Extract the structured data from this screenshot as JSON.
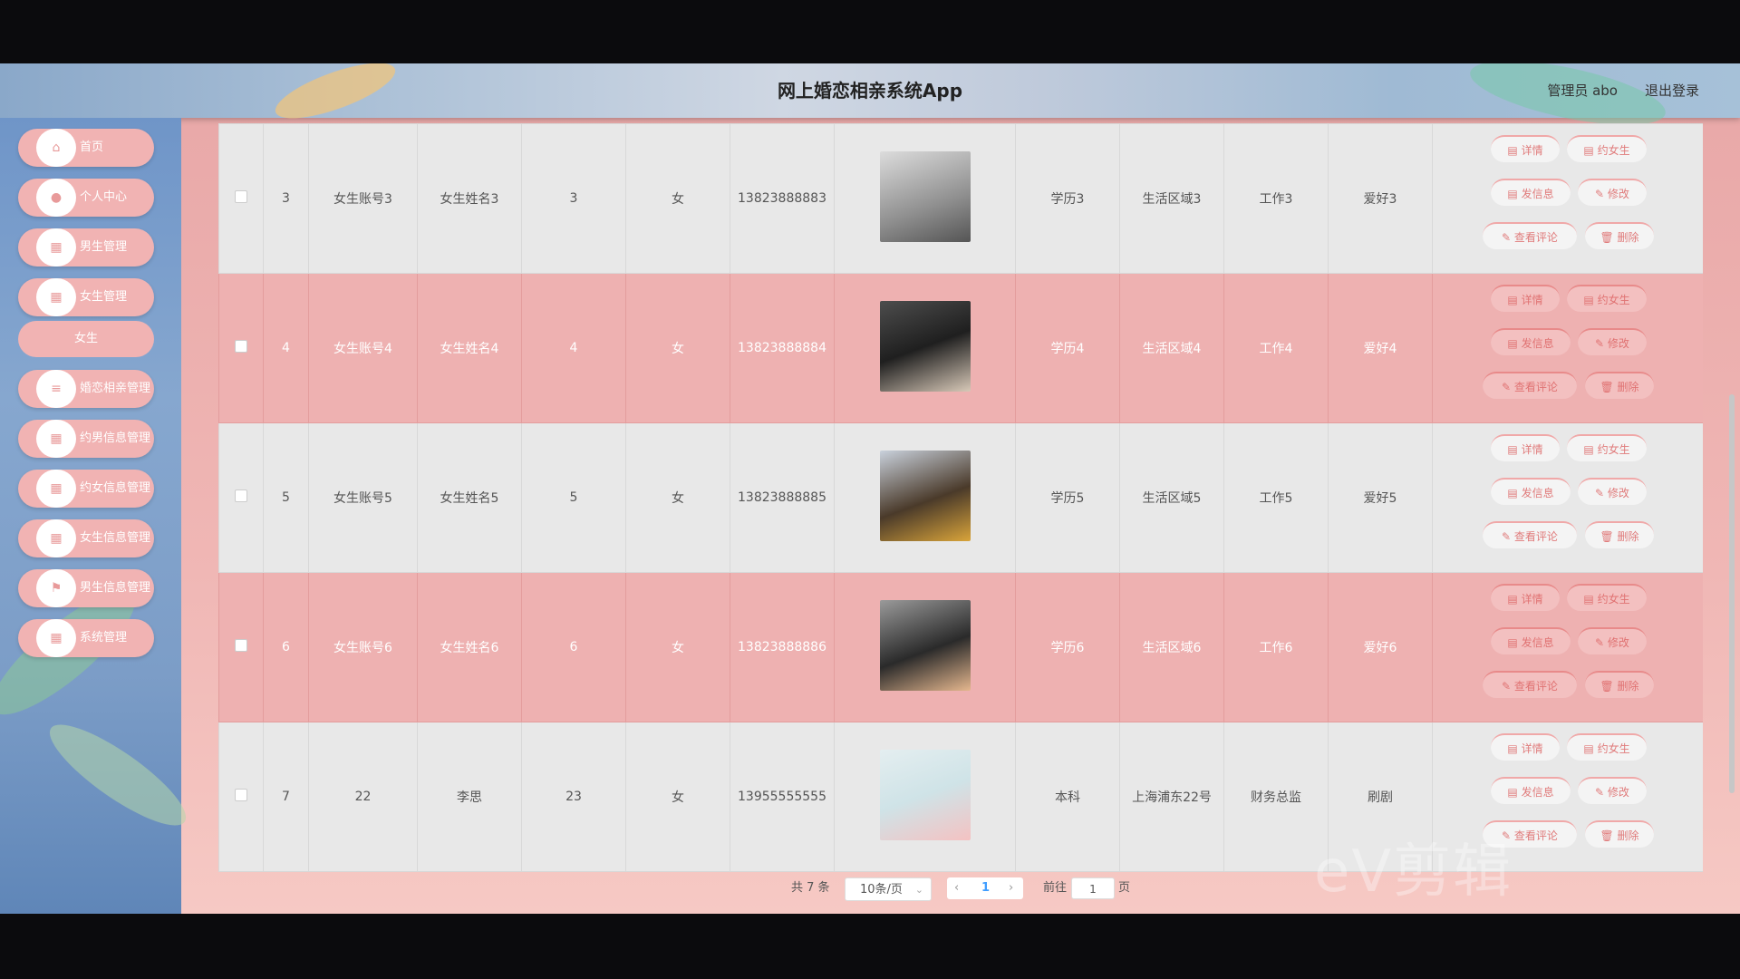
{
  "header": {
    "title": "网上婚恋相亲系统App",
    "admin": "管理员 abo",
    "logout": "退出登录"
  },
  "sidebar": {
    "items": [
      {
        "label": "首页",
        "icon": "home-icon"
      },
      {
        "label": "个人中心",
        "icon": "user-icon"
      },
      {
        "label": "男生管理",
        "icon": "grid-icon"
      },
      {
        "label": "女生管理",
        "icon": "grid-icon"
      },
      {
        "label": "婚恋相亲管理",
        "icon": "sliders-icon"
      },
      {
        "label": "约男信息管理",
        "icon": "grid-icon"
      },
      {
        "label": "约女信息管理",
        "icon": "grid-icon"
      },
      {
        "label": "女生信息管理",
        "icon": "grid-icon"
      },
      {
        "label": "男生信息管理",
        "icon": "flag-icon"
      },
      {
        "label": "系统管理",
        "icon": "grid-icon"
      }
    ],
    "submenu_item": "女生"
  },
  "table": {
    "rows": [
      {
        "idx": "3",
        "account": "女生账号3",
        "name": "女生姓名3",
        "age": "3",
        "gender": "女",
        "phone": "13823888883",
        "edu": "学历3",
        "area": "生活区域3",
        "job": "工作3",
        "hobby": "爱好3"
      },
      {
        "idx": "4",
        "account": "女生账号4",
        "name": "女生姓名4",
        "age": "4",
        "gender": "女",
        "phone": "13823888884",
        "edu": "学历4",
        "area": "生活区域4",
        "job": "工作4",
        "hobby": "爱好4"
      },
      {
        "idx": "5",
        "account": "女生账号5",
        "name": "女生姓名5",
        "age": "5",
        "gender": "女",
        "phone": "13823888885",
        "edu": "学历5",
        "area": "生活区域5",
        "job": "工作5",
        "hobby": "爱好5"
      },
      {
        "idx": "6",
        "account": "女生账号6",
        "name": "女生姓名6",
        "age": "6",
        "gender": "女",
        "phone": "13823888886",
        "edu": "学历6",
        "area": "生活区域6",
        "job": "工作6",
        "hobby": "爱好6"
      },
      {
        "idx": "7",
        "account": "22",
        "name": "李思",
        "age": "23",
        "gender": "女",
        "phone": "13955555555",
        "edu": "本科",
        "area": "上海浦东22号",
        "job": "财务总监",
        "hobby": "刷剧"
      }
    ],
    "buttons": {
      "detail": "详情",
      "date_girl": "约女生",
      "message": "发信息",
      "edit": "修改",
      "comments": "查看评论",
      "delete": "删除"
    }
  },
  "pagination": {
    "total": "共 7 条",
    "page_size": "10条/页",
    "current_page": "1",
    "goto_label": "前往",
    "goto_value": "1",
    "goto_suffix": "页",
    "prev": "‹",
    "next": "›"
  },
  "watermark": "eV剪辑",
  "colors": {
    "accent_pink": "#eeb1b1",
    "sidebar_blue": "#7c9dc7",
    "button_text": "#e07b7b",
    "page_active": "#409eff"
  }
}
